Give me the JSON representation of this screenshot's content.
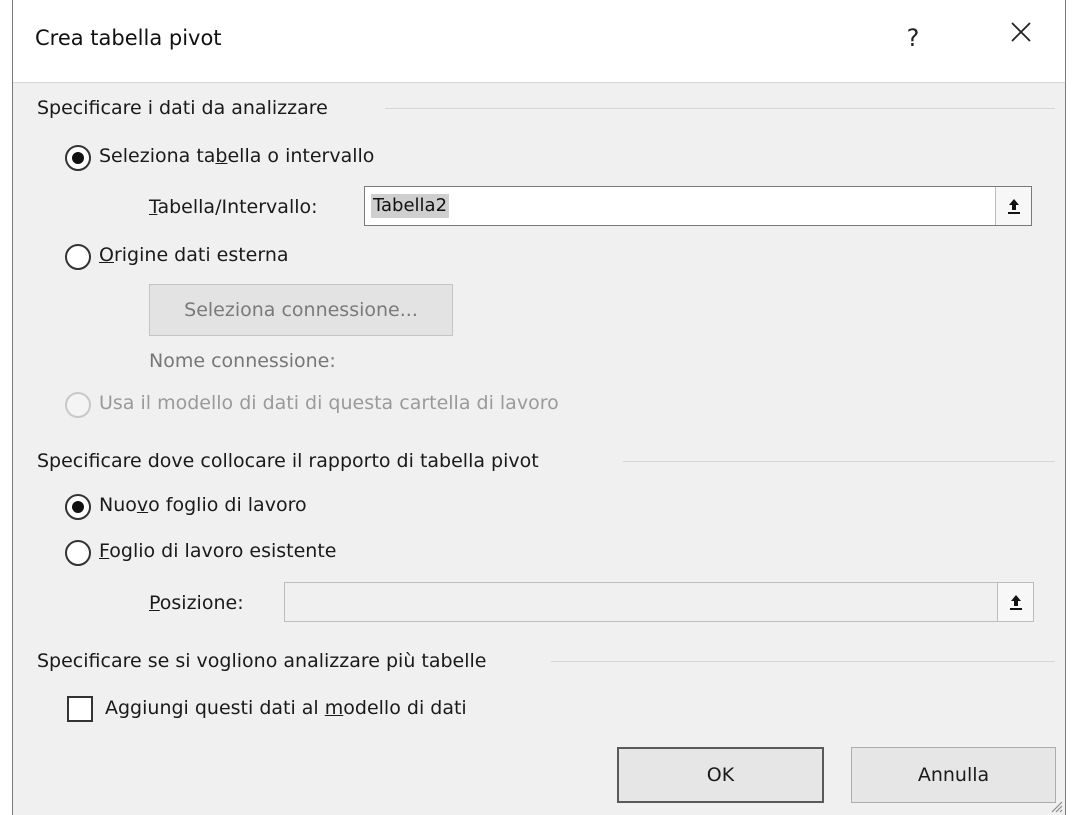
{
  "window": {
    "title": "Crea tabella pivot",
    "help_label": "?"
  },
  "section_data": {
    "title": "Specificare i dati da analizzare",
    "radio_table": {
      "pre": "Seleziona ta",
      "u": "b",
      "post": "ella o intervallo",
      "checked": true
    },
    "range_label": {
      "pre": "",
      "u": "T",
      "post": "abella/Intervallo:"
    },
    "range_value": "Tabella2",
    "radio_external": {
      "pre": "",
      "u": "O",
      "post": "rigine dati esterna",
      "checked": false
    },
    "select_connection_label": "Seleziona connessione...",
    "connection_name_label": "Nome connessione:",
    "radio_data_model": {
      "label": "Usa il modello di dati di questa cartella di lavoro",
      "enabled": false
    }
  },
  "section_location": {
    "title": "Specificare dove collocare il rapporto di tabella pivot",
    "radio_new_sheet": {
      "pre": "Nuo",
      "u": "v",
      "post": "o foglio di lavoro",
      "checked": true
    },
    "radio_existing_sheet": {
      "pre": "",
      "u": "F",
      "post": "oglio di lavoro esistente",
      "checked": false
    },
    "position_label": {
      "pre": "",
      "u": "P",
      "post": "osizione:"
    },
    "position_value": ""
  },
  "section_multi": {
    "title": "Specificare se si vogliono analizzare più tabelle",
    "checkbox": {
      "pre": "Aggiungi questi dati al ",
      "u": "m",
      "post": "odello di dati",
      "checked": false
    }
  },
  "buttons": {
    "ok": "OK",
    "cancel": "Annulla"
  },
  "icons": {
    "close": "close-icon",
    "range_picker": "collapse-dialog-icon",
    "resize": "resize-grip-icon"
  }
}
